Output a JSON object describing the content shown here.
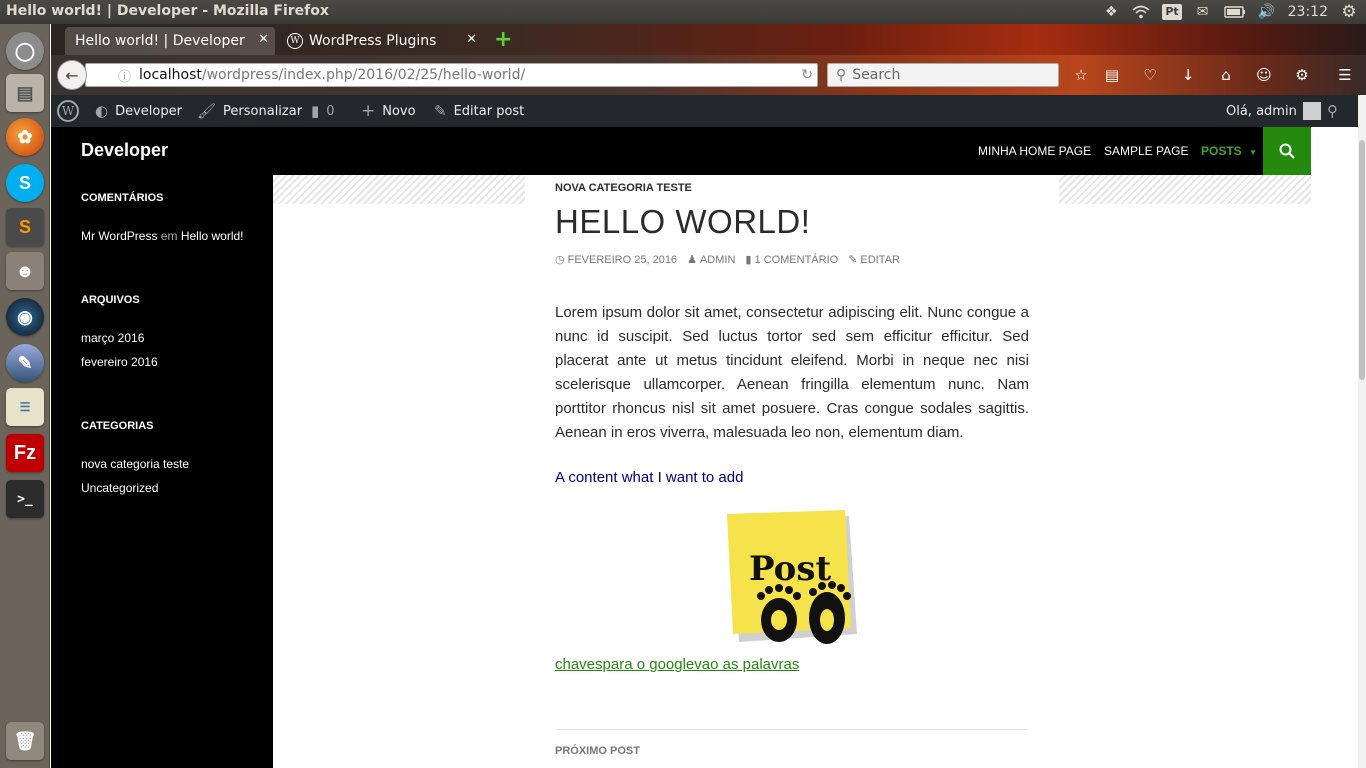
{
  "os_panel": {
    "window_title": "Hello world! | Developer - Mozilla Firefox",
    "keyboard_layout": "Pt",
    "clock": "23:12",
    "tray_icons": [
      "dropbox-icon",
      "wifi-icon",
      "keyboard-layout-indicator",
      "mail-icon",
      "battery-icon",
      "volume-icon",
      "clock",
      "settings-gear-icon"
    ]
  },
  "launcher": {
    "items": [
      "dash-home",
      "files",
      "firefox",
      "skype",
      "sublime-text",
      "gimp",
      "shotwell",
      "xpad",
      "libreoffice",
      "filezilla",
      "terminal",
      "trash"
    ]
  },
  "browser": {
    "tabs": [
      {
        "label": "Hello world! | Developer",
        "active": true
      },
      {
        "label": "WordPress Plugins",
        "active": false
      }
    ],
    "url_host": "localhost",
    "url_path": "/wordpress/index.php/2016/02/25/hello-world/",
    "search_placeholder": "Search"
  },
  "admin_bar": {
    "site_name": "Developer",
    "customize": "Personalizar",
    "comments_count": "0",
    "new": "Novo",
    "edit_post": "Editar post",
    "greeting": "Olá, admin"
  },
  "site": {
    "title": "Developer",
    "nav": [
      "MINHA HOME PAGE",
      "SAMPLE PAGE",
      "POSTS"
    ],
    "accent_color": "#24890d"
  },
  "sidebar": {
    "comments_title": "COMENTÁRIOS",
    "comment_author": "Mr WordPress",
    "comment_connector": "em",
    "comment_post": "Hello world!",
    "archives_title": "ARQUIVOS",
    "archives": [
      "março 2016",
      "fevereiro 2016"
    ],
    "categories_title": "CATEGORIAS",
    "categories": [
      "nova categoria teste",
      "Uncategorized"
    ]
  },
  "post": {
    "category": "NOVA CATEGORIA TESTE",
    "title": "HELLO WORLD!",
    "date": "FEVEREIRO 25, 2016",
    "author": "ADMIN",
    "comments": "1 COMENTÁRIO",
    "edit": "EDITAR",
    "body": "Lorem ipsum dolor sit amet, consectetur adipiscing elit. Nunc congue a nunc id suscipit. Sed luctus tortor sed sem efficitur efficitur. Sed placerat ante ut metus tincidunt eleifend. Morbi in neque nec nisi scelerisque ullamcorper. Aenean fringilla elementum nunc. Nam porttitor rhoncus nisl sit amet posuere. Cras congue sodales sagittis. Aenean in eros viverra, malesuada leo non, elementum diam.",
    "extra_content": "A content what I want to add",
    "image_text": "Post",
    "keyword_link": "chavespara o googlevao as palavras",
    "next_post_label": "PRÓXIMO POST"
  }
}
